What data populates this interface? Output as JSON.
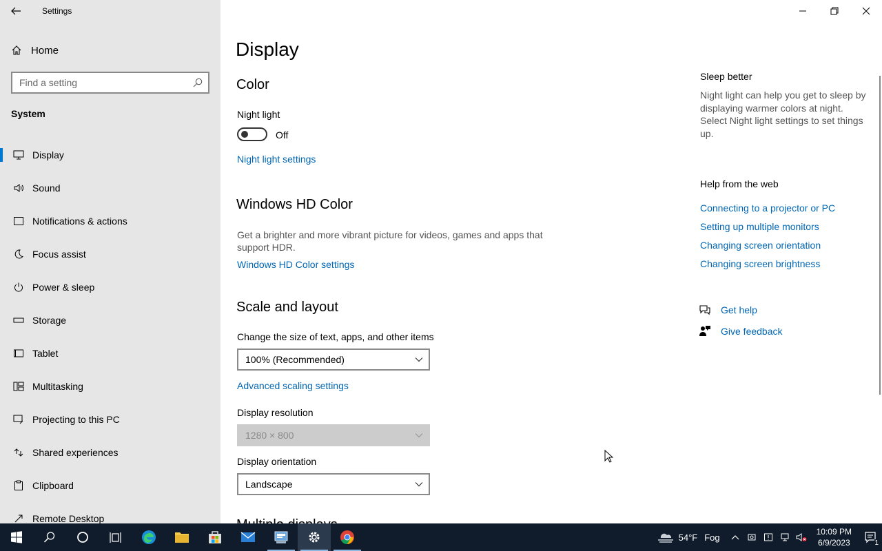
{
  "app": {
    "title": "Settings"
  },
  "sidebar": {
    "home_label": "Home",
    "search_placeholder": "Find a setting",
    "section": "System",
    "items": [
      {
        "label": "Display",
        "icon": "monitor-icon",
        "active": true
      },
      {
        "label": "Sound",
        "icon": "speaker-icon"
      },
      {
        "label": "Notifications & actions",
        "icon": "notification-icon"
      },
      {
        "label": "Focus assist",
        "icon": "moon-icon"
      },
      {
        "label": "Power & sleep",
        "icon": "power-icon"
      },
      {
        "label": "Storage",
        "icon": "storage-icon"
      },
      {
        "label": "Tablet",
        "icon": "tablet-icon"
      },
      {
        "label": "Multitasking",
        "icon": "multitasking-icon"
      },
      {
        "label": "Projecting to this PC",
        "icon": "projecting-icon"
      },
      {
        "label": "Shared experiences",
        "icon": "shared-experiences-icon"
      },
      {
        "label": "Clipboard",
        "icon": "clipboard-icon"
      },
      {
        "label": "Remote Desktop",
        "icon": "remote-desktop-icon"
      }
    ]
  },
  "main": {
    "title": "Display",
    "color": {
      "heading": "Color",
      "night_light_label": "Night light",
      "night_light_state": "Off",
      "night_light_link": "Night light settings"
    },
    "hd": {
      "heading": "Windows HD Color",
      "description": "Get a brighter and more vibrant picture for videos, games and apps that support HDR.",
      "link": "Windows HD Color settings"
    },
    "scale": {
      "heading": "Scale and layout",
      "size_label": "Change the size of text, apps, and other items",
      "size_value": "100% (Recommended)",
      "advanced_link": "Advanced scaling settings",
      "resolution_label": "Display resolution",
      "resolution_value": "1280 × 800",
      "orientation_label": "Display orientation",
      "orientation_value": "Landscape"
    },
    "next_heading": "Multiple displays"
  },
  "right": {
    "sleep_heading": "Sleep better",
    "sleep_text": "Night light can help you get to sleep by displaying warmer colors at night. Select Night light settings to set things up.",
    "web_heading": "Help from the web",
    "web_links": [
      "Connecting to a projector or PC",
      "Setting up multiple monitors",
      "Changing screen orientation",
      "Changing screen brightness"
    ],
    "get_help": "Get help",
    "give_feedback": "Give feedback"
  },
  "taskbar": {
    "weather_temp": "54°F",
    "weather_text": "Fog",
    "time": "10:09 PM",
    "date": "6/9/2023",
    "notification_count": "1"
  },
  "colors": {
    "accent": "#0078d4",
    "link": "#0066b4",
    "taskbar": "#101c2c"
  }
}
